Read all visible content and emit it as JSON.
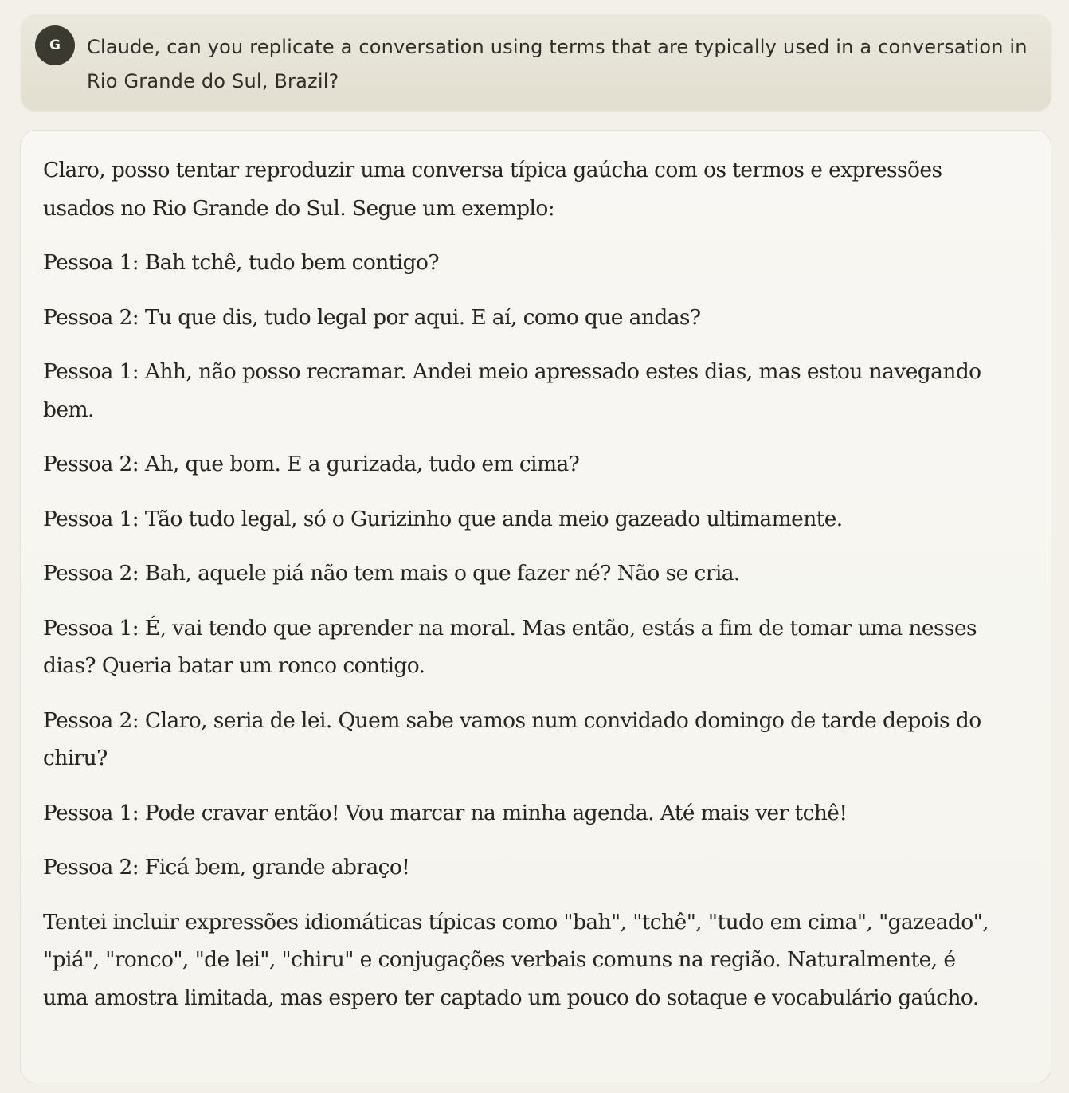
{
  "user_message": {
    "avatar_initial": "G",
    "text": "Claude, can you replicate a conversation using terms that are typically used in a conversation in Rio Grande do Sul, Brazil?"
  },
  "assistant_message": {
    "paragraphs": [
      "Claro, posso tentar reproduzir uma conversa típica gaúcha com os termos e expressões usados no Rio Grande do Sul. Segue um exemplo:",
      "Pessoa 1: Bah tchê, tudo bem contigo?",
      "Pessoa 2: Tu que dis, tudo legal por aqui. E aí, como que andas?",
      "Pessoa 1: Ahh, não posso recramar. Andei meio apressado estes dias, mas estou navegando bem.",
      "Pessoa 2: Ah, que bom. E a gurizada, tudo em cima?",
      "Pessoa 1: Tão tudo legal, só o Gurizinho que anda meio gazeado ultimamente.",
      "Pessoa 2: Bah, aquele piá não tem mais o que fazer né? Não se cria.",
      "Pessoa 1: É, vai tendo que aprender na moral. Mas então, estás a fim de tomar uma nesses dias? Queria batar um ronco contigo.",
      "Pessoa 2: Claro, seria  de lei. Quem sabe vamos num convidado domingo de tarde depois do chiru?",
      "Pessoa 1: Pode cravar então! Vou marcar na minha agenda. Até mais ver tchê!",
      "Pessoa 2: Ficá bem, grande abraço!",
      "Tentei incluir expressões idiomáticas típicas como \"bah\", \"tchê\", \"tudo em cima\", \"gazeado\", \"piá\", \"ronco\", \"de lei\", \"chiru\" e conjugações verbais comuns na região. Naturalmente, é uma amostra limitada, mas espero ter captado um pouco do sotaque e vocabulário gaúcho."
    ]
  }
}
